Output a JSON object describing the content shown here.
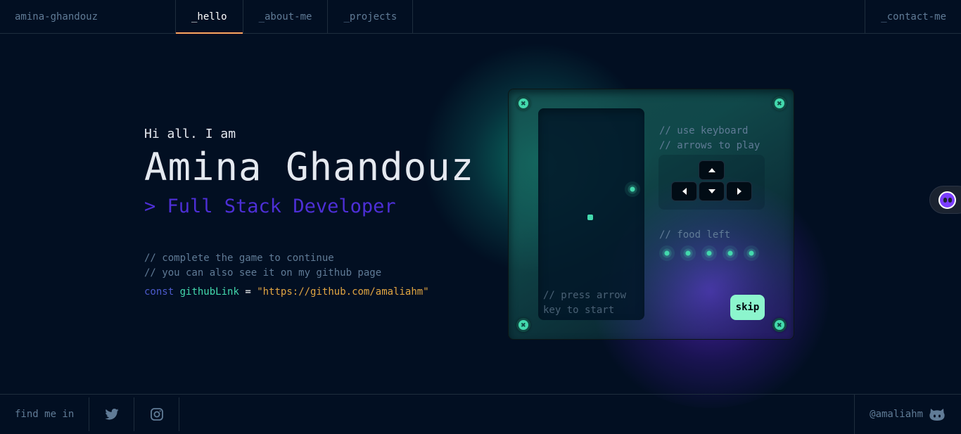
{
  "header": {
    "brand": "amina-ghandouz",
    "tabs": [
      {
        "label": "_hello",
        "active": true
      },
      {
        "label": "_about-me",
        "active": false
      },
      {
        "label": "_projects",
        "active": false
      }
    ],
    "contact_label": "_contact-me"
  },
  "intro": {
    "greeting": "Hi all. I am",
    "name": "Amina Ghandouz",
    "role": "> Full Stack Developer",
    "comment1": "// complete the game to continue",
    "comment2": "// you can also see it on my github page",
    "code": {
      "keyword": "const",
      "variable": "githubLink",
      "equals": "=",
      "value": "\"https://github.com/amaliahm\""
    }
  },
  "game": {
    "instructions1": "// use keyboard",
    "instructions2": "// arrows to play",
    "press_hint": "// press arrow key to start",
    "food_label": "// food left",
    "food_count": 5,
    "skip_label": "skip",
    "keys": [
      "arrow-up",
      "arrow-left",
      "arrow-down",
      "arrow-right"
    ]
  },
  "footer": {
    "find_me": "find me in",
    "socials": [
      "twitter-icon",
      "instagram-icon"
    ],
    "github_handle": "@amaliahm"
  },
  "colors": {
    "background": "#020f22",
    "accent_tab": "#fea55f",
    "role": "#4d2fd6",
    "keyword": "#4d5bce",
    "variable": "#43d9ad",
    "string": "#e2a642",
    "skip_button": "#8cf5cd"
  }
}
